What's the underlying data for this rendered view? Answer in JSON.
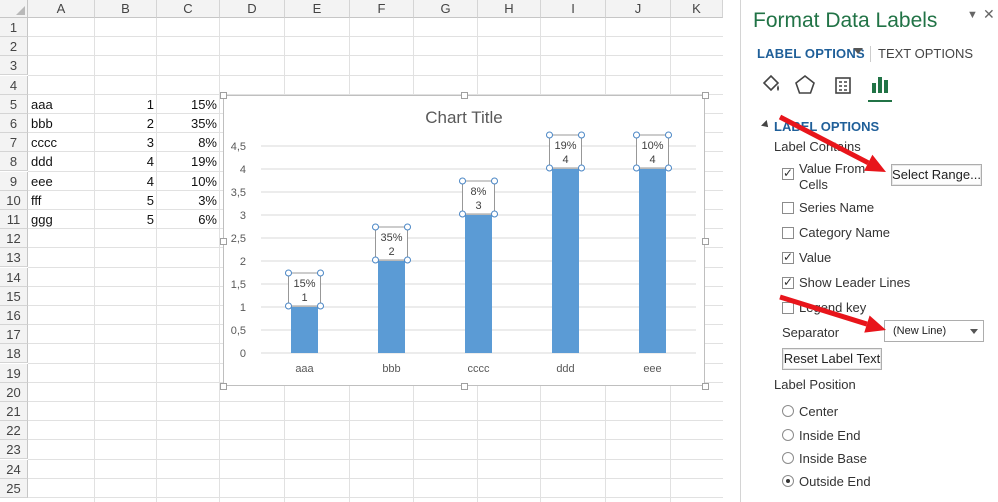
{
  "sheet": {
    "columns": [
      "A",
      "B",
      "C",
      "D",
      "E",
      "F",
      "G",
      "H",
      "I",
      "J",
      "K"
    ],
    "rows": [
      "1",
      "2",
      "3",
      "4",
      "5",
      "6",
      "7",
      "8",
      "9",
      "10",
      "11",
      "12",
      "13",
      "14",
      "15",
      "16",
      "17",
      "18",
      "19",
      "20",
      "21",
      "22",
      "23",
      "24",
      "25"
    ],
    "data": [
      {
        "row": 5,
        "a": "aaa",
        "b": "1",
        "c": "15%"
      },
      {
        "row": 6,
        "a": "bbb",
        "b": "2",
        "c": "35%"
      },
      {
        "row": 7,
        "a": "cccc",
        "b": "3",
        "c": "8%"
      },
      {
        "row": 8,
        "a": "ddd",
        "b": "4",
        "c": "19%"
      },
      {
        "row": 9,
        "a": "eee",
        "b": "4",
        "c": "10%"
      },
      {
        "row": 10,
        "a": "fff",
        "b": "5",
        "c": "3%"
      },
      {
        "row": 11,
        "a": "ggg",
        "b": "5",
        "c": "6%"
      }
    ]
  },
  "chart_data": {
    "type": "bar",
    "title": "Chart Title",
    "categories": [
      "aaa",
      "bbb",
      "cccc",
      "ddd",
      "eee"
    ],
    "values": [
      1,
      2,
      3,
      4,
      4
    ],
    "data_labels": [
      "15%",
      "35%",
      "8%",
      "19%",
      "10%"
    ],
    "value_labels": [
      "1",
      "2",
      "3",
      "4",
      "4"
    ],
    "yticks": [
      "0",
      "0,5",
      "1",
      "1,5",
      "2",
      "2,5",
      "3",
      "3,5",
      "4",
      "4,5"
    ],
    "ylim": [
      0,
      4.5
    ],
    "grid": true,
    "bar_color": "#5b9bd5"
  },
  "panel": {
    "title": "Format Data Labels",
    "tab_label_options": "LABEL OPTIONS",
    "tab_text_options": "TEXT OPTIONS",
    "section_title": "LABEL OPTIONS",
    "label_contains": "Label Contains",
    "value_from_cells_line1": "Value From",
    "value_from_cells_line2": "Cells",
    "select_range_button": "Select Range...",
    "series_name": "Series Name",
    "category_name": "Category Name",
    "value": "Value",
    "show_leader_lines": "Show Leader Lines",
    "legend_key": "Legend key",
    "separator_label": "Separator",
    "separator_value": "(New Line)",
    "reset_label_text": "Reset Label Text",
    "label_position": "Label Position",
    "position_center": "Center",
    "position_inside_end": "Inside End",
    "position_inside_base": "Inside Base",
    "position_outside_end": "Outside End",
    "checks": {
      "value_from_cells": true,
      "series_name": false,
      "category_name": false,
      "value": true,
      "show_leader_lines": true,
      "legend_key": false
    },
    "selected_position": "outside_end",
    "accent_color": "#217346",
    "heading_color": "#1f5f99"
  },
  "annotations": {
    "arrow_color": "#e8151b"
  }
}
